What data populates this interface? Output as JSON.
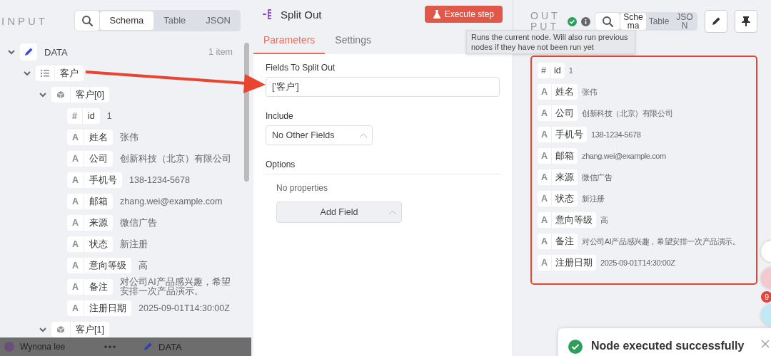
{
  "input_panel": {
    "title": "INPUT",
    "view_tabs": [
      {
        "label": "Schema",
        "selected": true
      },
      {
        "label": "Table",
        "selected": false
      },
      {
        "label": "JSON",
        "selected": false
      }
    ],
    "tree": [
      {
        "kind": "node",
        "label": "DATA",
        "count": "1 item",
        "expanded": true,
        "children": [
          {
            "kind": "array",
            "label": "客户",
            "expanded": true,
            "children": [
              {
                "kind": "object",
                "label": "客户[0]",
                "expanded": true,
                "children": [
                  {
                    "kind": "field",
                    "type_glyph": "#",
                    "label": "id",
                    "value": "1"
                  },
                  {
                    "kind": "field",
                    "type_glyph": "A",
                    "label": "姓名",
                    "value": "张伟"
                  },
                  {
                    "kind": "field",
                    "type_glyph": "A",
                    "label": "公司",
                    "value": "创新科技（北京）有限公司"
                  },
                  {
                    "kind": "field",
                    "type_glyph": "A",
                    "label": "手机号",
                    "value": "138-1234-5678"
                  },
                  {
                    "kind": "field",
                    "type_glyph": "A",
                    "label": "邮箱",
                    "value": "zhang.wei@example.com"
                  },
                  {
                    "kind": "field",
                    "type_glyph": "A",
                    "label": "来源",
                    "value": "微信广告"
                  },
                  {
                    "kind": "field",
                    "type_glyph": "A",
                    "label": "状态",
                    "value": "新注册"
                  },
                  {
                    "kind": "field",
                    "type_glyph": "A",
                    "label": "意向等级",
                    "value": "高"
                  },
                  {
                    "kind": "field",
                    "type_glyph": "A",
                    "label": "备注",
                    "value": "对公司AI产品感兴趣，希望安排一次产品演示。"
                  },
                  {
                    "kind": "field",
                    "type_glyph": "A",
                    "label": "注册日期",
                    "value": "2025-09-01T14:30:00Z"
                  }
                ]
              },
              {
                "kind": "object",
                "label": "客户[1]",
                "expanded": true
              }
            ]
          }
        ]
      }
    ]
  },
  "node_panel": {
    "title": "Split Out",
    "execute_button": "Execute step",
    "tabs": [
      {
        "label": "Parameters",
        "selected": true
      },
      {
        "label": "Settings",
        "selected": false
      }
    ],
    "fields_to_split_out": {
      "label": "Fields To Split Out",
      "value": "['客户']"
    },
    "include": {
      "label": "Include",
      "value": "No Other Fields"
    },
    "options": {
      "label": "Options",
      "empty_text": "No properties",
      "add_button": "Add Field"
    }
  },
  "tooltip": "Runs the current node. Will also run previous nodes if they have not been run yet",
  "output_panel": {
    "title": "OUTPUT",
    "view_tabs": [
      {
        "label": "Schema",
        "selected": true
      },
      {
        "label": "Table",
        "selected": false
      },
      {
        "label": "JSON",
        "selected": false
      }
    ],
    "fields": [
      {
        "type_glyph": "#",
        "label": "id",
        "value": "1"
      },
      {
        "type_glyph": "A",
        "label": "姓名",
        "value": "张伟"
      },
      {
        "type_glyph": "A",
        "label": "公司",
        "value": "创新科技（北京）有限公司"
      },
      {
        "type_glyph": "A",
        "label": "手机号",
        "value": "138-1234-5678"
      },
      {
        "type_glyph": "A",
        "label": "邮箱",
        "value": "zhang.wei@example.com"
      },
      {
        "type_glyph": "A",
        "label": "来源",
        "value": "微信广告"
      },
      {
        "type_glyph": "A",
        "label": "状态",
        "value": "新注册"
      },
      {
        "type_glyph": "A",
        "label": "意向等级",
        "value": "高"
      },
      {
        "type_glyph": "A",
        "label": "备注",
        "value": "对公司AI产品感兴趣，希望安排一次产品演示。"
      },
      {
        "type_glyph": "A",
        "label": "注册日期",
        "value": "2025-09-01T14:30:00Z"
      }
    ]
  },
  "bottom_bar": {
    "user_name": "Wynona lee",
    "node_label": "DATA"
  },
  "notification_badge": "9",
  "toast": {
    "message": "Node executed successfully"
  }
}
